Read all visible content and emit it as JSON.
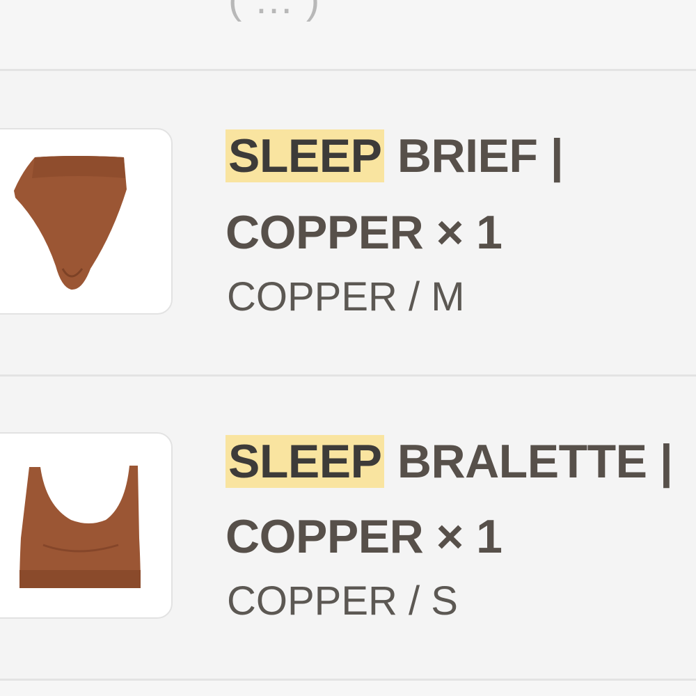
{
  "top_fragment": "( ... )",
  "items": [
    {
      "highlight": "SLEEP",
      "title_rest": " BRIEF |",
      "title_line2": "COPPER × 1",
      "variant": "COPPER / M",
      "image_icon": "brief-icon",
      "product_color": "#9b5634"
    },
    {
      "highlight": "SLEEP",
      "title_rest": " BRALETTE |",
      "title_line2": "COPPER × 1",
      "variant": "COPPER / S",
      "image_icon": "bralette-icon",
      "product_color": "#9b5634"
    }
  ],
  "colors": {
    "highlight_bg": "#f9e4a0",
    "title_text": "#57504a",
    "variant_text": "#5c5853",
    "background": "#f6f6f6"
  }
}
